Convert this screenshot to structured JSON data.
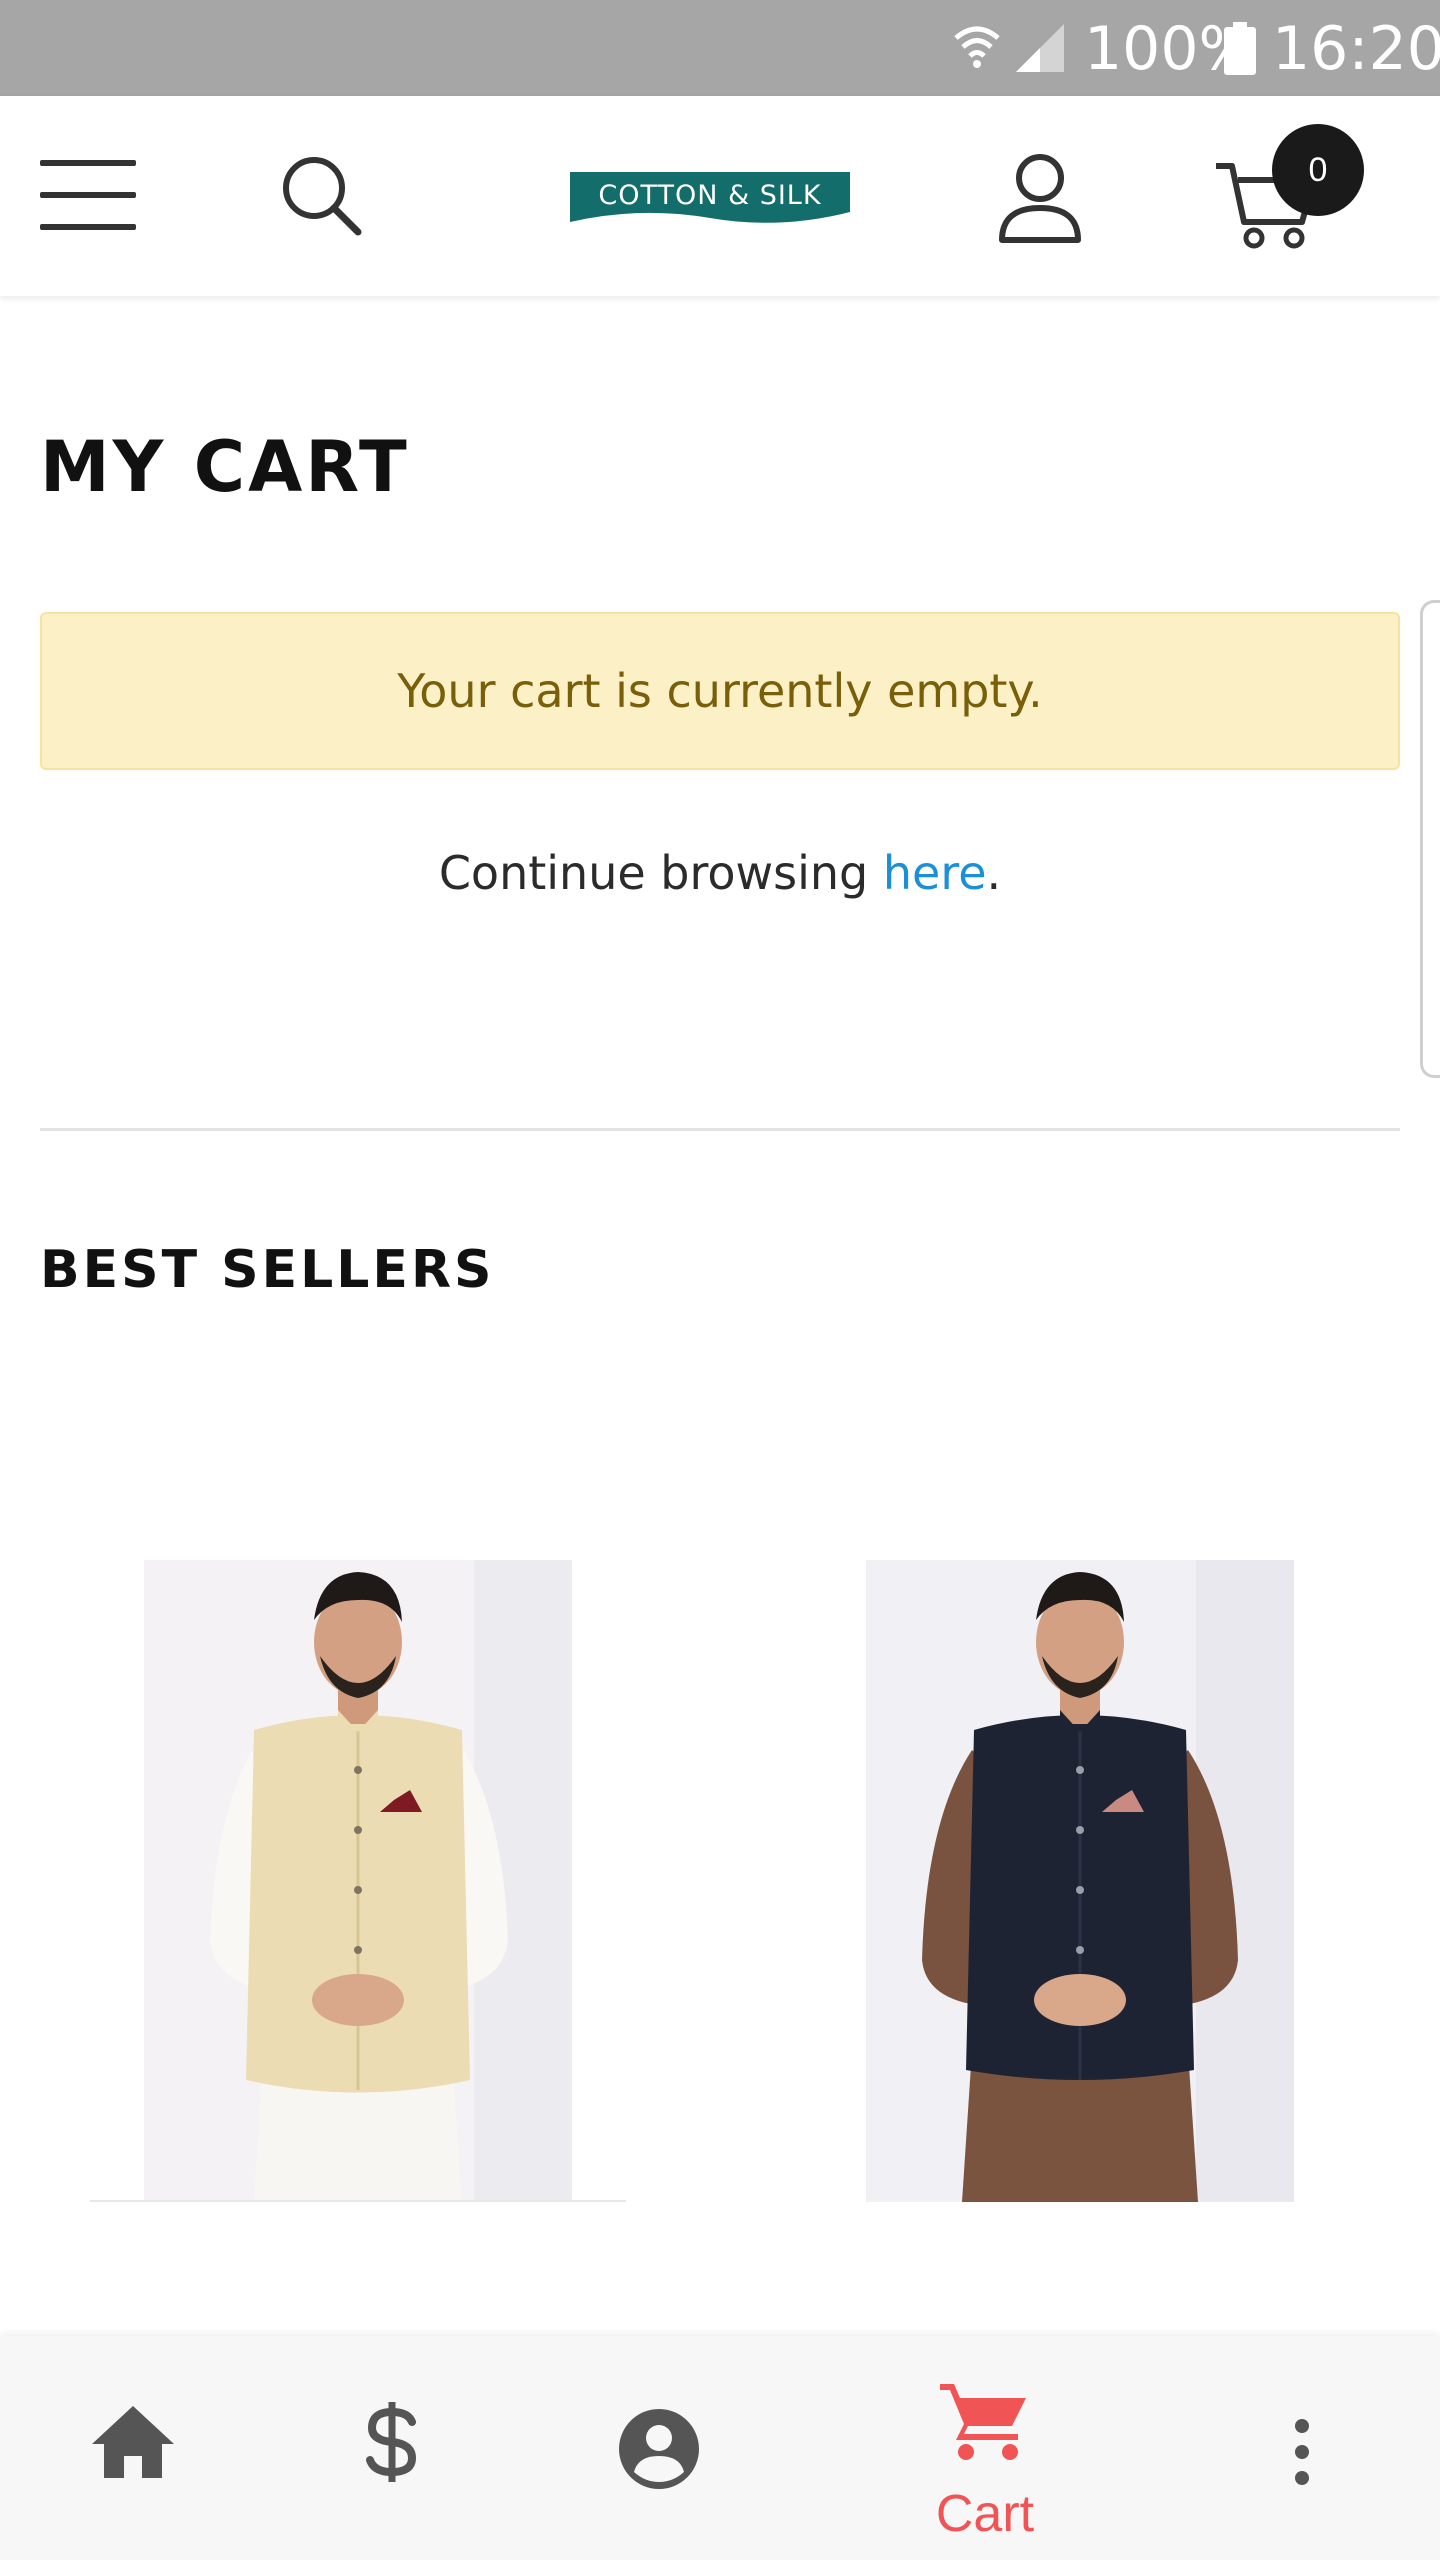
{
  "status_bar": {
    "battery_percent": "100%",
    "time": "16:20",
    "background": "#a6a6a6"
  },
  "header": {
    "brand": "COTTON & SILK",
    "brand_color": "#136d6b",
    "cart_count": "0",
    "icons": [
      "menu-icon",
      "search-icon",
      "user-icon",
      "cart-icon"
    ]
  },
  "cart_page": {
    "title": "MY CART",
    "empty_message": "Your cart is currently empty.",
    "continue_prefix": "Continue browsing ",
    "continue_link": "here",
    "continue_suffix": ".",
    "alert_background": "#fcf1c6",
    "link_color": "#1c8fd9"
  },
  "best_sellers": {
    "title": "BEST SELLERS",
    "products": [
      {
        "image": "man in cream waistcoat over white kurta"
      },
      {
        "image": "man in navy waistcoat over brown kurta"
      }
    ]
  },
  "bottom_nav": {
    "items": [
      {
        "icon": "home-icon"
      },
      {
        "icon": "dollar-icon"
      },
      {
        "icon": "account-icon"
      },
      {
        "icon": "cart-icon",
        "label": "Cart",
        "active": true
      },
      {
        "icon": "more-vertical-icon"
      }
    ],
    "active_color": "#f05454",
    "inactive_color": "#555555"
  }
}
